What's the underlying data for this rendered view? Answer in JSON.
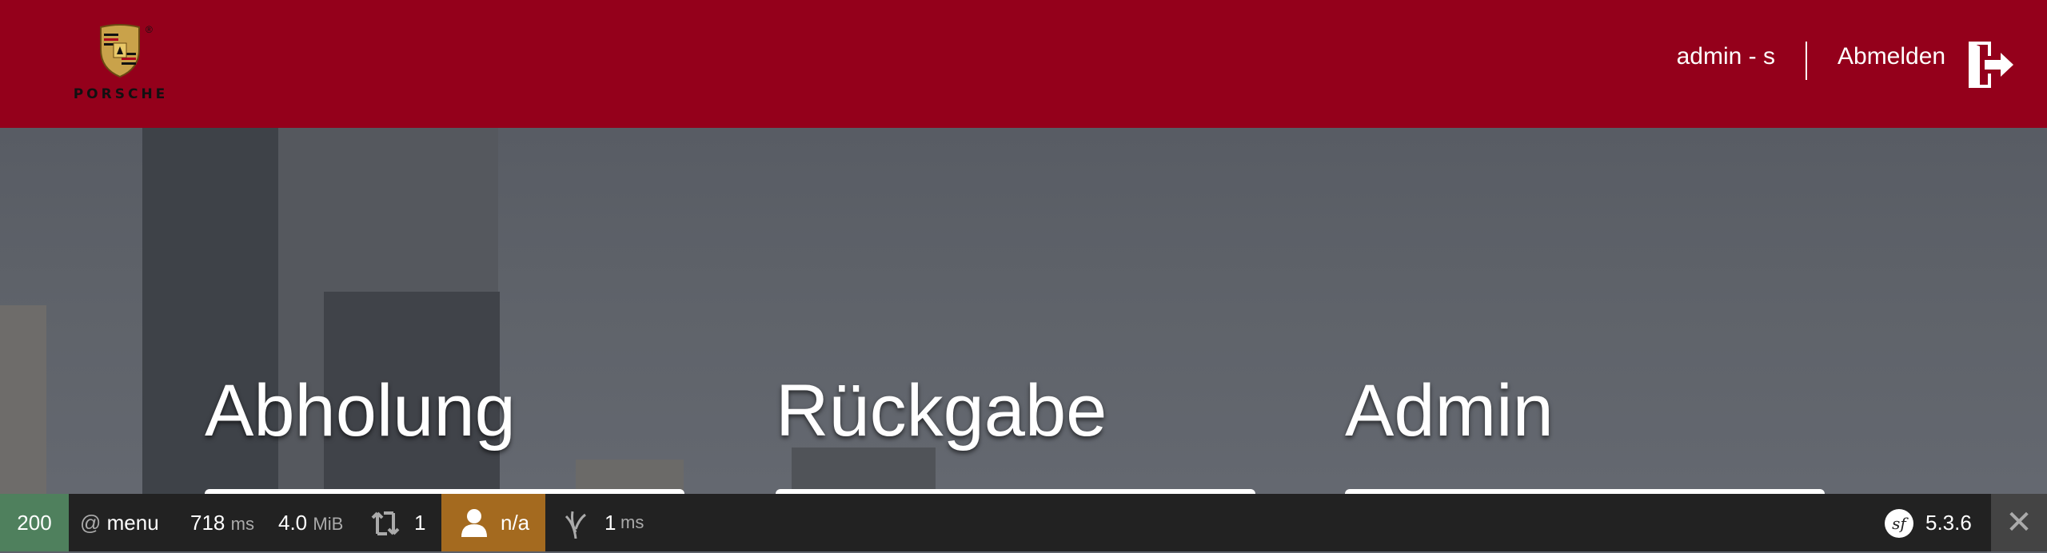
{
  "header": {
    "brand": "PORSCHE",
    "brand_reg": "®",
    "user": "admin - s",
    "logout": "Abmelden"
  },
  "sections": [
    {
      "title": "Abholung"
    },
    {
      "title": "Rückgabe"
    },
    {
      "title": "Admin"
    }
  ],
  "toolbar": {
    "status_code": "200",
    "route_prefix": "@",
    "route": "menu",
    "time_value": "718",
    "time_unit": "ms",
    "memory_value": "4.0",
    "memory_unit": "MiB",
    "requests": "1",
    "user": "n/a",
    "db_time_value": "1",
    "db_time_unit": "ms",
    "symfony_version": "5.3.6",
    "close": "✕"
  },
  "colors": {
    "brand_red": "#94001b",
    "status_ok": "#4f805d",
    "user_badge": "#a46a1f",
    "toolbar_bg": "#222222"
  }
}
